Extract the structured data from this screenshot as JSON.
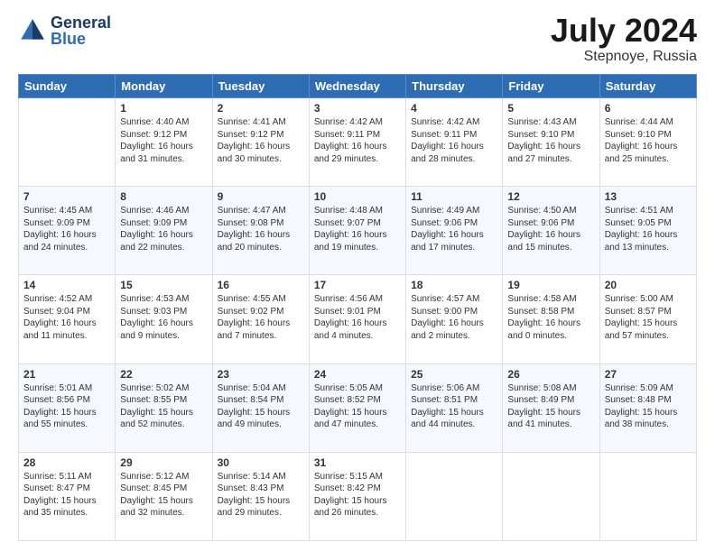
{
  "header": {
    "logo_text_general": "General",
    "logo_text_blue": "Blue",
    "title": "July 2024",
    "location": "Stepnoye, Russia"
  },
  "days_of_week": [
    "Sunday",
    "Monday",
    "Tuesday",
    "Wednesday",
    "Thursday",
    "Friday",
    "Saturday"
  ],
  "weeks": [
    [
      {
        "day": "",
        "lines": []
      },
      {
        "day": "1",
        "lines": [
          "Sunrise: 4:40 AM",
          "Sunset: 9:12 PM",
          "Daylight: 16 hours",
          "and 31 minutes."
        ]
      },
      {
        "day": "2",
        "lines": [
          "Sunrise: 4:41 AM",
          "Sunset: 9:12 PM",
          "Daylight: 16 hours",
          "and 30 minutes."
        ]
      },
      {
        "day": "3",
        "lines": [
          "Sunrise: 4:42 AM",
          "Sunset: 9:11 PM",
          "Daylight: 16 hours",
          "and 29 minutes."
        ]
      },
      {
        "day": "4",
        "lines": [
          "Sunrise: 4:42 AM",
          "Sunset: 9:11 PM",
          "Daylight: 16 hours",
          "and 28 minutes."
        ]
      },
      {
        "day": "5",
        "lines": [
          "Sunrise: 4:43 AM",
          "Sunset: 9:10 PM",
          "Daylight: 16 hours",
          "and 27 minutes."
        ]
      },
      {
        "day": "6",
        "lines": [
          "Sunrise: 4:44 AM",
          "Sunset: 9:10 PM",
          "Daylight: 16 hours",
          "and 25 minutes."
        ]
      }
    ],
    [
      {
        "day": "7",
        "lines": [
          "Sunrise: 4:45 AM",
          "Sunset: 9:09 PM",
          "Daylight: 16 hours",
          "and 24 minutes."
        ]
      },
      {
        "day": "8",
        "lines": [
          "Sunrise: 4:46 AM",
          "Sunset: 9:09 PM",
          "Daylight: 16 hours",
          "and 22 minutes."
        ]
      },
      {
        "day": "9",
        "lines": [
          "Sunrise: 4:47 AM",
          "Sunset: 9:08 PM",
          "Daylight: 16 hours",
          "and 20 minutes."
        ]
      },
      {
        "day": "10",
        "lines": [
          "Sunrise: 4:48 AM",
          "Sunset: 9:07 PM",
          "Daylight: 16 hours",
          "and 19 minutes."
        ]
      },
      {
        "day": "11",
        "lines": [
          "Sunrise: 4:49 AM",
          "Sunset: 9:06 PM",
          "Daylight: 16 hours",
          "and 17 minutes."
        ]
      },
      {
        "day": "12",
        "lines": [
          "Sunrise: 4:50 AM",
          "Sunset: 9:06 PM",
          "Daylight: 16 hours",
          "and 15 minutes."
        ]
      },
      {
        "day": "13",
        "lines": [
          "Sunrise: 4:51 AM",
          "Sunset: 9:05 PM",
          "Daylight: 16 hours",
          "and 13 minutes."
        ]
      }
    ],
    [
      {
        "day": "14",
        "lines": [
          "Sunrise: 4:52 AM",
          "Sunset: 9:04 PM",
          "Daylight: 16 hours",
          "and 11 minutes."
        ]
      },
      {
        "day": "15",
        "lines": [
          "Sunrise: 4:53 AM",
          "Sunset: 9:03 PM",
          "Daylight: 16 hours",
          "and 9 minutes."
        ]
      },
      {
        "day": "16",
        "lines": [
          "Sunrise: 4:55 AM",
          "Sunset: 9:02 PM",
          "Daylight: 16 hours",
          "and 7 minutes."
        ]
      },
      {
        "day": "17",
        "lines": [
          "Sunrise: 4:56 AM",
          "Sunset: 9:01 PM",
          "Daylight: 16 hours",
          "and 4 minutes."
        ]
      },
      {
        "day": "18",
        "lines": [
          "Sunrise: 4:57 AM",
          "Sunset: 9:00 PM",
          "Daylight: 16 hours",
          "and 2 minutes."
        ]
      },
      {
        "day": "19",
        "lines": [
          "Sunrise: 4:58 AM",
          "Sunset: 8:58 PM",
          "Daylight: 16 hours",
          "and 0 minutes."
        ]
      },
      {
        "day": "20",
        "lines": [
          "Sunrise: 5:00 AM",
          "Sunset: 8:57 PM",
          "Daylight: 15 hours",
          "and 57 minutes."
        ]
      }
    ],
    [
      {
        "day": "21",
        "lines": [
          "Sunrise: 5:01 AM",
          "Sunset: 8:56 PM",
          "Daylight: 15 hours",
          "and 55 minutes."
        ]
      },
      {
        "day": "22",
        "lines": [
          "Sunrise: 5:02 AM",
          "Sunset: 8:55 PM",
          "Daylight: 15 hours",
          "and 52 minutes."
        ]
      },
      {
        "day": "23",
        "lines": [
          "Sunrise: 5:04 AM",
          "Sunset: 8:54 PM",
          "Daylight: 15 hours",
          "and 49 minutes."
        ]
      },
      {
        "day": "24",
        "lines": [
          "Sunrise: 5:05 AM",
          "Sunset: 8:52 PM",
          "Daylight: 15 hours",
          "and 47 minutes."
        ]
      },
      {
        "day": "25",
        "lines": [
          "Sunrise: 5:06 AM",
          "Sunset: 8:51 PM",
          "Daylight: 15 hours",
          "and 44 minutes."
        ]
      },
      {
        "day": "26",
        "lines": [
          "Sunrise: 5:08 AM",
          "Sunset: 8:49 PM",
          "Daylight: 15 hours",
          "and 41 minutes."
        ]
      },
      {
        "day": "27",
        "lines": [
          "Sunrise: 5:09 AM",
          "Sunset: 8:48 PM",
          "Daylight: 15 hours",
          "and 38 minutes."
        ]
      }
    ],
    [
      {
        "day": "28",
        "lines": [
          "Sunrise: 5:11 AM",
          "Sunset: 8:47 PM",
          "Daylight: 15 hours",
          "and 35 minutes."
        ]
      },
      {
        "day": "29",
        "lines": [
          "Sunrise: 5:12 AM",
          "Sunset: 8:45 PM",
          "Daylight: 15 hours",
          "and 32 minutes."
        ]
      },
      {
        "day": "30",
        "lines": [
          "Sunrise: 5:14 AM",
          "Sunset: 8:43 PM",
          "Daylight: 15 hours",
          "and 29 minutes."
        ]
      },
      {
        "day": "31",
        "lines": [
          "Sunrise: 5:15 AM",
          "Sunset: 8:42 PM",
          "Daylight: 15 hours",
          "and 26 minutes."
        ]
      },
      {
        "day": "",
        "lines": []
      },
      {
        "day": "",
        "lines": []
      },
      {
        "day": "",
        "lines": []
      }
    ]
  ]
}
